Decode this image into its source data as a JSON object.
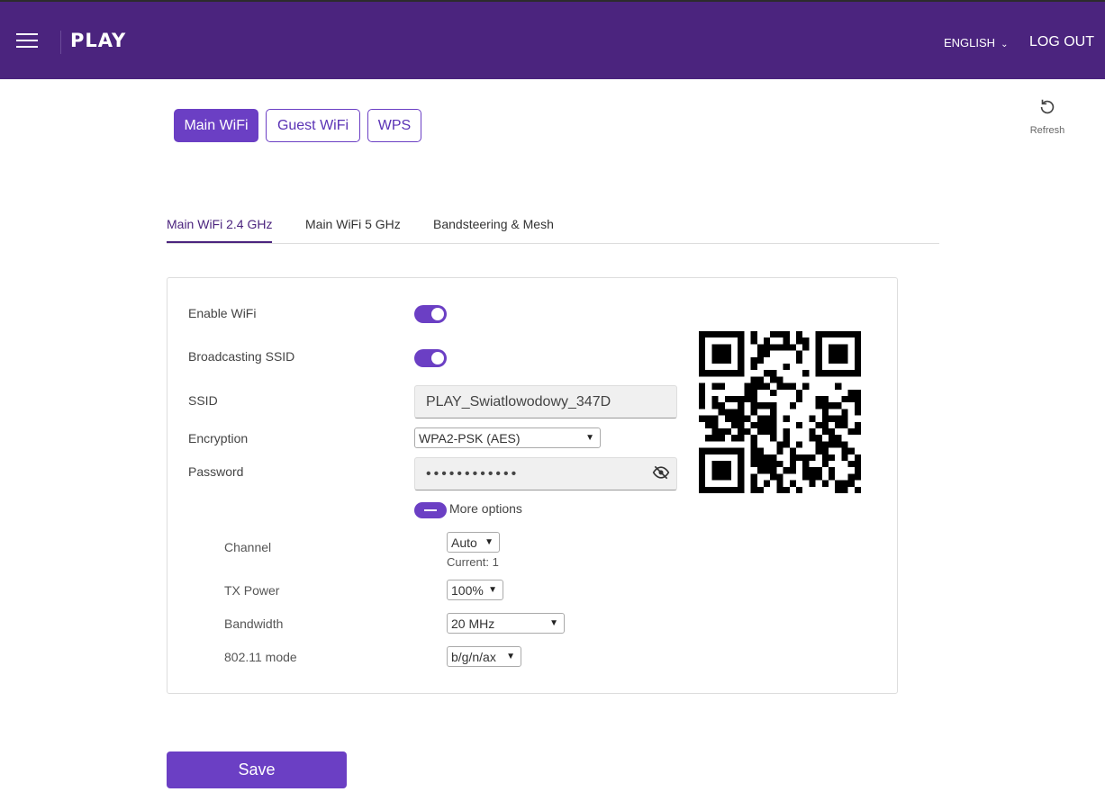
{
  "header": {
    "logo": "PLAY",
    "language": "ENGLISH",
    "logout": "LOG OUT"
  },
  "wifi_tabs": [
    {
      "label": "Main WiFi",
      "active": true
    },
    {
      "label": "Guest WiFi",
      "active": false
    },
    {
      "label": "WPS",
      "active": false
    }
  ],
  "refresh": {
    "label": "Refresh",
    "icon": "refresh-icon"
  },
  "band_tabs": [
    {
      "label": "Main WiFi 2.4 GHz",
      "active": true
    },
    {
      "label": "Main WiFi 5 GHz",
      "active": false
    },
    {
      "label": "Bandsteering & Mesh",
      "active": false
    }
  ],
  "form": {
    "enable_wifi": {
      "label": "Enable WiFi",
      "on": true
    },
    "broadcast_ssid": {
      "label": "Broadcasting SSID",
      "on": true
    },
    "ssid": {
      "label": "SSID",
      "value": "PLAY_Swiatlowodowy_347D"
    },
    "encryption": {
      "label": "Encryption",
      "value": "WPA2-PSK (AES)"
    },
    "password": {
      "label": "Password",
      "value": "••••••••••••",
      "icon": "eye-slash-icon"
    },
    "more_options": {
      "label": "More options"
    },
    "channel": {
      "label": "Channel",
      "value": "Auto",
      "current": "Current: 1"
    },
    "tx_power": {
      "label": "TX Power",
      "value": "100%"
    },
    "bandwidth": {
      "label": "Bandwidth",
      "value": "20 MHz"
    },
    "mode": {
      "label": "802.11 mode",
      "value": "b/g/n/ax"
    }
  },
  "save_label": "Save",
  "colors": {
    "header": "#4b247e",
    "accent": "#6b3fc4"
  }
}
